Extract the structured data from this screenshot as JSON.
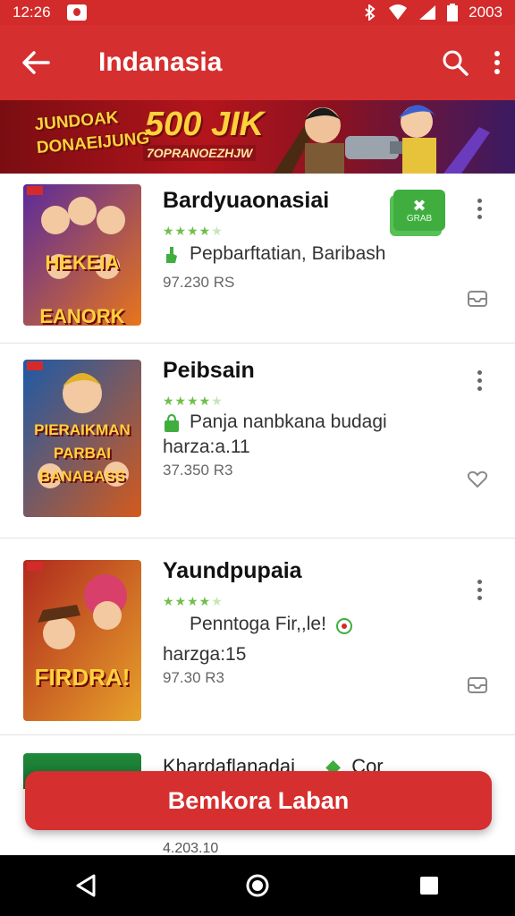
{
  "status_bar": {
    "time": "12:26",
    "right_text": "2003",
    "icons": [
      "notification-icon",
      "bluetooth-icon",
      "wifi-icon",
      "signal-icon",
      "battery-icon"
    ]
  },
  "app_bar": {
    "title": "Indanasia",
    "icons": [
      "back-arrow-icon",
      "search-icon",
      "more-vert-icon"
    ]
  },
  "banner": {
    "left_text": "JUNDOAK DONAEIJUNG",
    "amount": "500 JIK",
    "sub_text": "7OPRANOEZHJW"
  },
  "games": [
    {
      "title": "Bardyuaonasiai",
      "rating": 4,
      "description": "Pepbarftatian, Baribash",
      "price": "97.230 RS",
      "thumb_text": "HEKEIA EANORK",
      "thumb_colors": [
        "#5a2a9c",
        "#e8761b"
      ]
    },
    {
      "title": "Peibsain",
      "rating": 4,
      "description": "Panja nanbkana budagi",
      "harga": "harza:a.11",
      "price": "37.350 R3",
      "thumb_text": "PIERAIKMAN PARBAI BANABASS",
      "thumb_colors": [
        "#1c5aa8",
        "#d45a1c"
      ]
    },
    {
      "title": "Yaundpupaia",
      "rating": 4,
      "description": "Penntoga Fir,,le!",
      "harga": "harzga:15",
      "price": "97.30 R3",
      "thumb_text": "FIRDRA!",
      "thumb_colors": [
        "#b02a1e",
        "#e7a12a"
      ]
    }
  ],
  "partial_card": {
    "title": "Khardaflanadai",
    "extra": "Cor",
    "price": "4.203.10"
  },
  "install_badge": {
    "label": "GRAB"
  },
  "cta_label": "Bemkora Laban",
  "colors": {
    "primary": "#d62f2f",
    "accent_green": "#3fae3f",
    "star": "#6fbf4a"
  }
}
